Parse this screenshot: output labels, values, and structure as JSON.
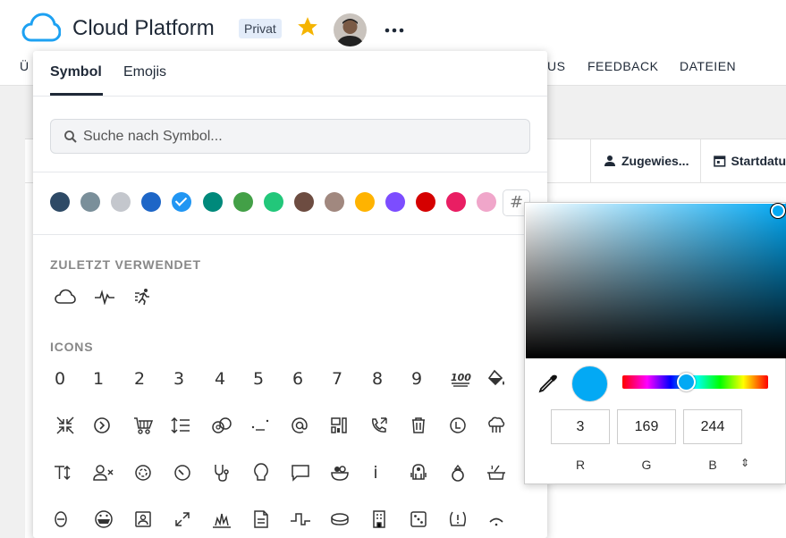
{
  "header": {
    "title": "Cloud Platform",
    "badge": "Privat",
    "nav": {
      "partial_left": "Ü",
      "partial_status": "US",
      "feedback": "FEEDBACK",
      "files": "DATEIEN"
    }
  },
  "board": {
    "columns": {
      "assignee": "Zugewies...",
      "start_date": "Startdatu"
    }
  },
  "picker": {
    "tabs": {
      "symbol": "Symbol",
      "emojis": "Emojis"
    },
    "search": {
      "placeholder": "Suche nach Symbol..."
    },
    "swatches": [
      "#2e4a66",
      "#7a8f9a",
      "#c4c7cd",
      "#1e66c7",
      "#2196f3",
      "#00897b",
      "#43a047",
      "#22c77a",
      "#6d4c41",
      "#a1887f",
      "#ffb300",
      "#7c4dff",
      "#d50000",
      "#e91e63",
      "#f0a6ca"
    ],
    "selected_swatch_index": 4,
    "hash_label": "#",
    "recent_label": "ZULETZT VERWENDET",
    "icons_label": "ICONS",
    "icons_row1": [
      "0",
      "1",
      "2",
      "3",
      "4",
      "5",
      "6",
      "7",
      "8",
      "9"
    ],
    "icons_row3_text": "Tᴉ",
    "info_glyph": "i"
  },
  "color_picker": {
    "hex": "#03a9f4",
    "r": "3",
    "g": "169",
    "b": "244",
    "r_label": "R",
    "g_label": "G",
    "b_label": "B"
  }
}
